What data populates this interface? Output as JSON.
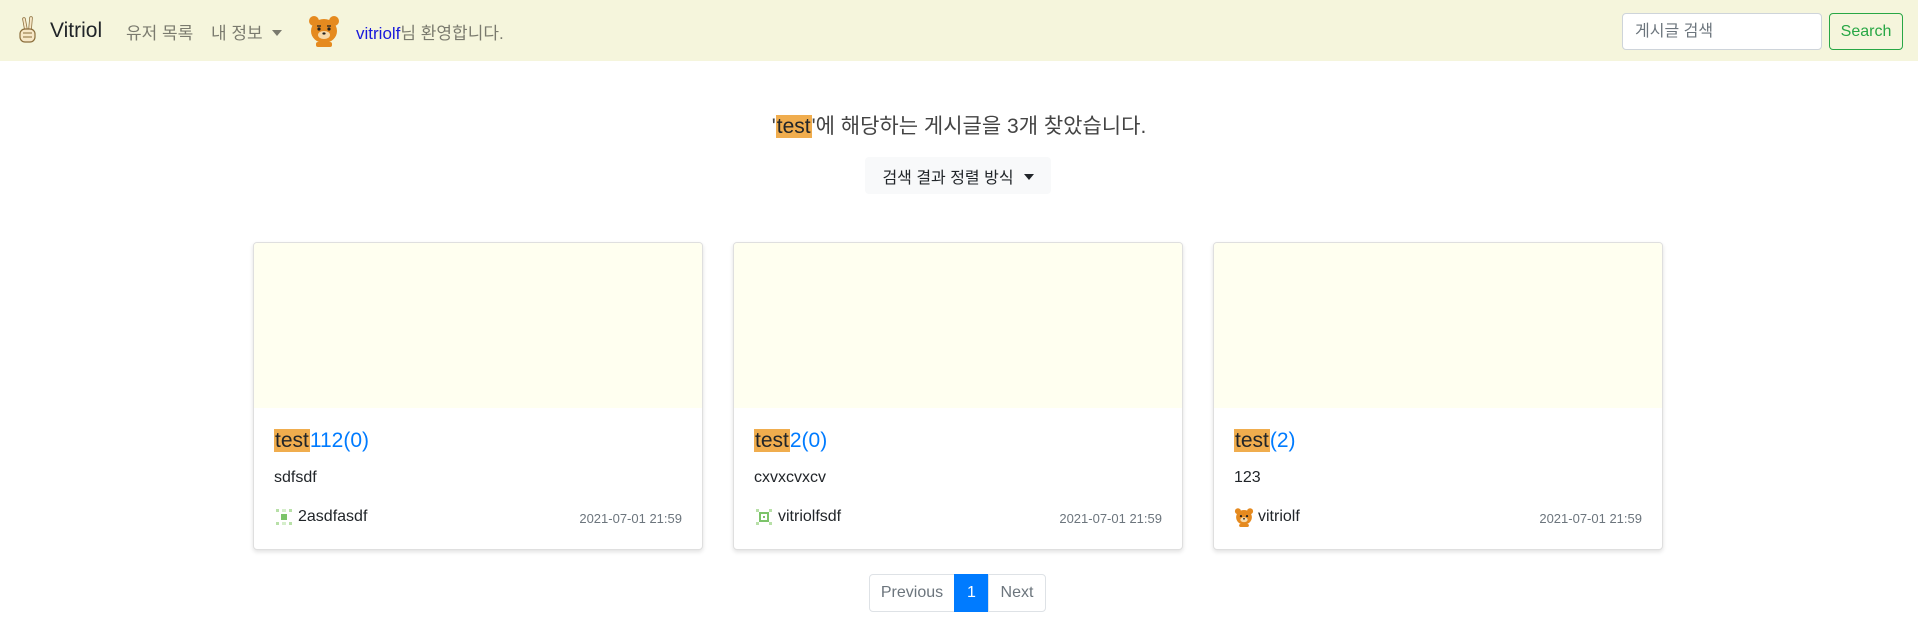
{
  "navbar": {
    "brand": "Vitriol",
    "nav_users": "유저 목록",
    "nav_my_info": "내 정보",
    "welcome_user": "vitriolf",
    "welcome_suffix": "님 환영합니다.",
    "search_placeholder": "게시글 검색",
    "search_button": "Search"
  },
  "results": {
    "quote_open": "'",
    "query": "test",
    "suffix_part1": "'에 해당하는 게시글을 ",
    "count": "3",
    "suffix_part2": "개 찾았습니다.",
    "sort_label": "검색 결과 정렬 방식"
  },
  "posts": [
    {
      "title_match": "test",
      "title_rest": "112(0)",
      "excerpt": "sdfsdf",
      "author": "2asdfasdf",
      "author_avatar": "pixel-identicon",
      "date": "2021-07-01 21:59"
    },
    {
      "title_match": "test",
      "title_rest": "2(0)",
      "excerpt": "cxvxcvxcv",
      "author": "vitriolfsdf",
      "author_avatar": "pixel-identicon",
      "date": "2021-07-01 21:59"
    },
    {
      "title_match": "test",
      "title_rest": "(2)",
      "excerpt": "123",
      "author": "vitriolf",
      "author_avatar": "bear-avatar",
      "date": "2021-07-01 21:59"
    }
  ],
  "pagination": {
    "previous": "Previous",
    "current": "1",
    "next": "Next"
  },
  "colors": {
    "navbar_bg": "#f5f5dc",
    "highlight": "#f0ad4e",
    "link": "#007bff",
    "success": "#28a745",
    "card_image_bg": "#fffff0"
  }
}
